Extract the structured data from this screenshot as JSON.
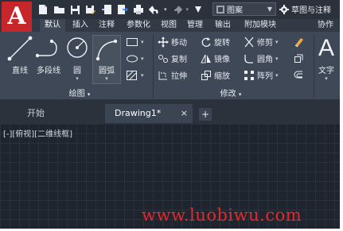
{
  "app": {
    "logo_letter": "A",
    "brand_color": "#c7262b"
  },
  "quick_access": {
    "icons": [
      "new-file-icon",
      "open-folder-icon",
      "save-icon",
      "save-as-icon",
      "import-icon",
      "export-icon",
      "print-icon",
      "undo-icon",
      "redo-icon",
      "share-icon"
    ],
    "layer_value": "图案",
    "workspace_label": "草图与注释"
  },
  "ribbon_tabs": [
    "默认",
    "插入",
    "注释",
    "参数化",
    "视图",
    "管理",
    "输出",
    "附加模块",
    "协作"
  ],
  "active_tab": "默认",
  "draw_panel": {
    "line": "直线",
    "polyline": "多段线",
    "circle": "圆",
    "arc": "圆弧",
    "title": "绘图"
  },
  "modify_panel": {
    "move": "移动",
    "rotate": "旋转",
    "trim": "修剪",
    "copy": "复制",
    "mirror": "镜像",
    "fillet": "圆角",
    "stretch": "拉伸",
    "scale": "缩放",
    "array": "阵列",
    "title": "修改"
  },
  "annotation_panel": {
    "text": "文字"
  },
  "file_tabs": {
    "start": "开始",
    "drawing": "Drawing1*",
    "close": "×",
    "new_tab": "+"
  },
  "viewport": {
    "label": "[-][俯视][二维线框]"
  },
  "watermark": "www.luobiwu.com",
  "colors": {
    "ribbon_bg": "#3f4856",
    "canvas_bg": "#1f252e",
    "watermark": "#e8262b"
  }
}
